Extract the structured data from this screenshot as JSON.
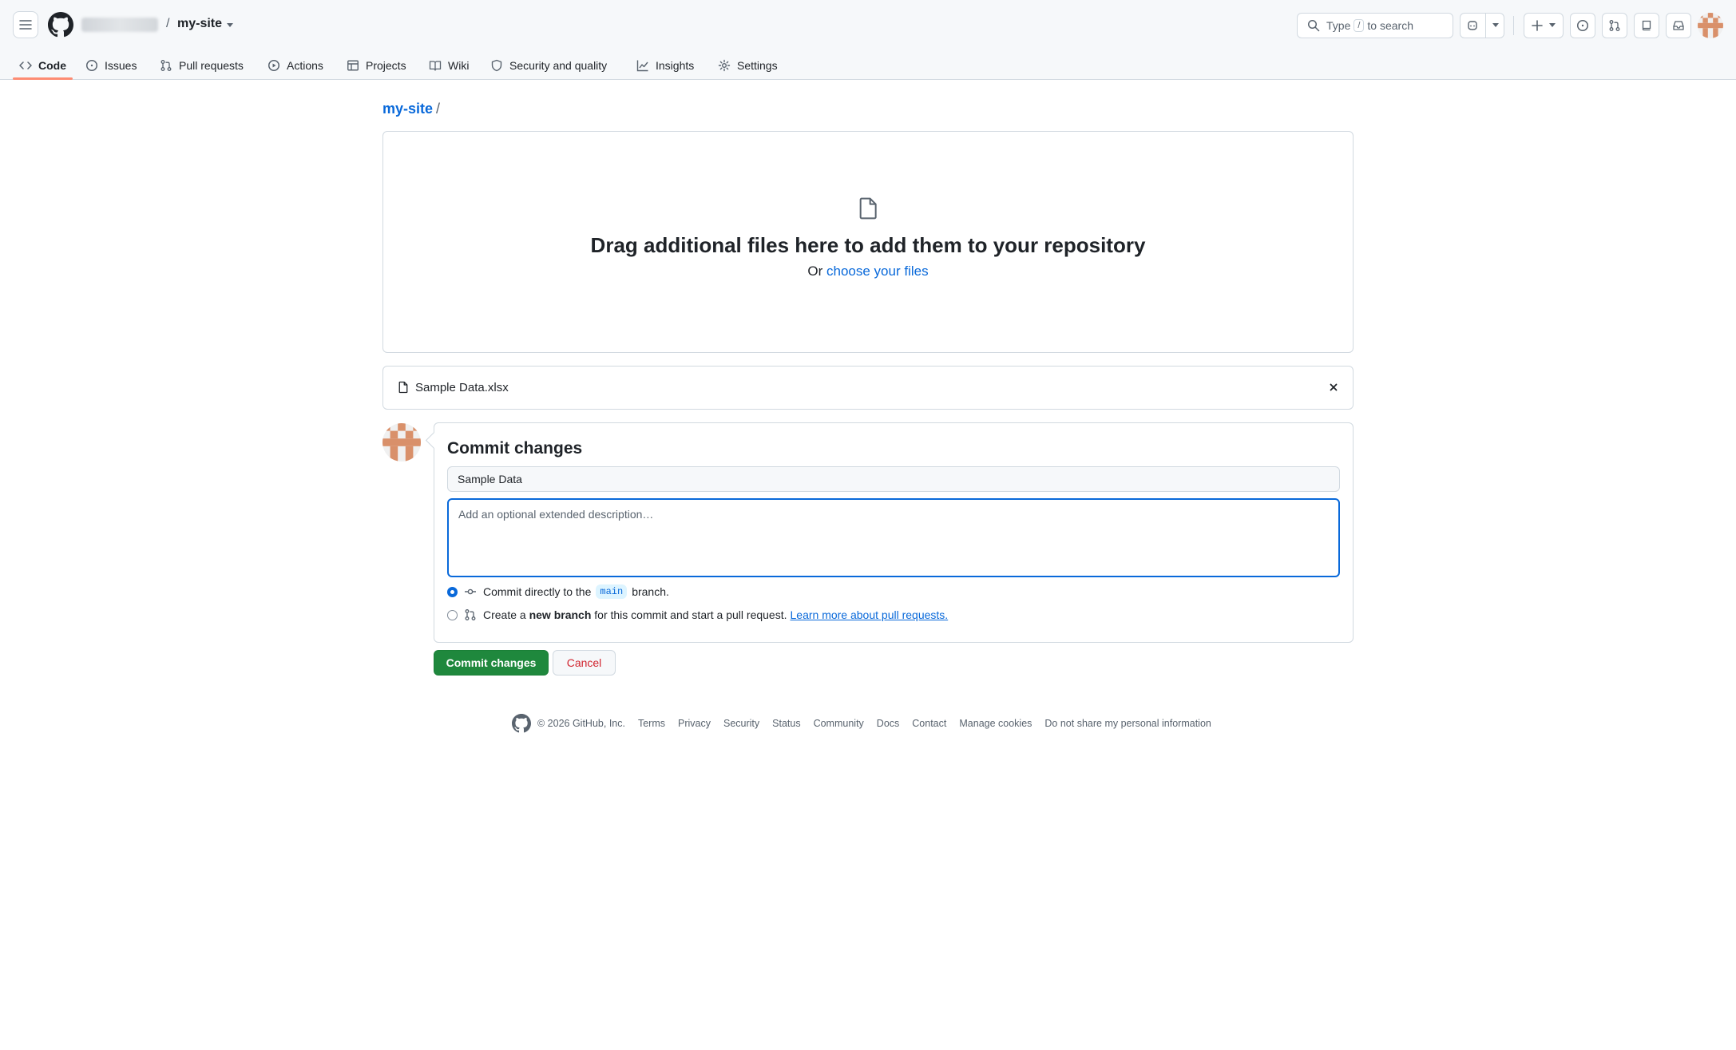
{
  "header": {
    "repo_name": "my-site",
    "separator": "/",
    "search": {
      "prefix": "Type",
      "key": "/",
      "suffix": "to search"
    }
  },
  "tabs": [
    {
      "label": "Code",
      "icon": "code-icon",
      "active": true
    },
    {
      "label": "Issues",
      "icon": "issue-opened-icon"
    },
    {
      "label": "Pull requests",
      "icon": "git-pull-request-icon"
    },
    {
      "label": "Actions",
      "icon": "play-icon"
    },
    {
      "label": "Projects",
      "icon": "table-icon"
    },
    {
      "label": "Wiki",
      "icon": "book-icon"
    },
    {
      "label": "Security and quality",
      "icon": "shield-icon"
    },
    {
      "label": "Insights",
      "icon": "graph-icon"
    },
    {
      "label": "Settings",
      "icon": "gear-icon"
    }
  ],
  "breadcrumb": {
    "repo": "my-site",
    "separator": "/"
  },
  "dropzone": {
    "title": "Drag additional files here to add them to your repository",
    "or_text": "Or",
    "choose_link": "choose your files"
  },
  "file": {
    "name": "Sample Data.xlsx"
  },
  "commit": {
    "title": "Commit changes",
    "message_value": "Sample Data",
    "description_placeholder": "Add an optional extended description…",
    "option_direct": {
      "prefix": "Commit directly to the",
      "branch": "main",
      "suffix": "branch.",
      "checked": true
    },
    "option_new": {
      "prefix": "Create a",
      "bold": "new branch",
      "suffix": "for this commit and start a pull request.",
      "link": "Learn more about pull requests.",
      "checked": false
    },
    "submit_label": "Commit changes",
    "cancel_label": "Cancel"
  },
  "footer": {
    "copyright": "© 2026 GitHub, Inc.",
    "links": [
      "Terms",
      "Privacy",
      "Security",
      "Status",
      "Community",
      "Docs",
      "Contact",
      "Manage cookies",
      "Do not share my personal information"
    ]
  },
  "colors": {
    "accent": "#0969da",
    "primary_button": "#1f883d",
    "danger": "#d1242f",
    "tab_underline": "#fd8c73"
  }
}
